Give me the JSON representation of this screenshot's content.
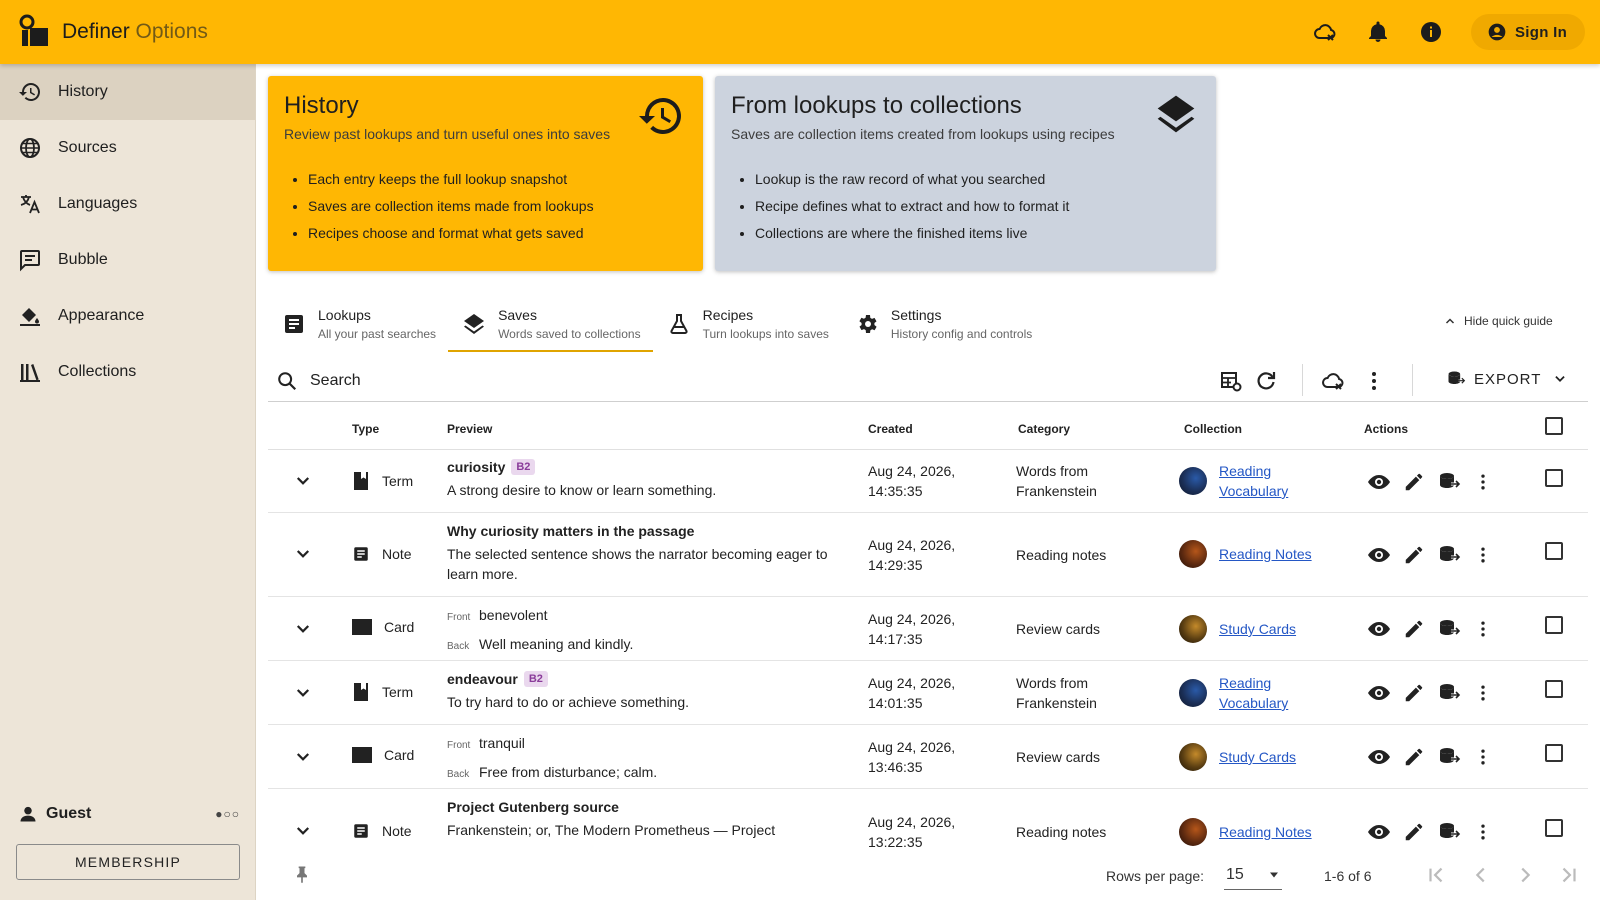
{
  "app": {
    "title_main": "Definer",
    "title_sub": "Options",
    "sign_in": "Sign In"
  },
  "topbar_icons": [
    "cloud-off-icon",
    "bell-icon",
    "info-icon"
  ],
  "sidebar": {
    "items": [
      {
        "label": "History",
        "icon": "history-icon",
        "active": true
      },
      {
        "label": "Sources",
        "icon": "globe-icon"
      },
      {
        "label": "Languages",
        "icon": "translate-icon"
      },
      {
        "label": "Bubble",
        "icon": "chat-bubble-icon"
      },
      {
        "label": "Appearance",
        "icon": "paint-bucket-icon"
      },
      {
        "label": "Collections",
        "icon": "library-icon"
      }
    ],
    "user": "Guest",
    "user_dots": "●○○",
    "membership": "MEMBERSHIP"
  },
  "guide": {
    "history": {
      "title": "History",
      "desc": "Review past lookups and turn useful ones into saves",
      "bullets": [
        "Each entry keeps the full lookup snapshot",
        "Saves are collection items made from lookups",
        "Recipes choose and format what gets saved"
      ]
    },
    "from": {
      "title": "From lookups to collections",
      "desc": "Saves are collection items created from lookups using recipes",
      "bullets": [
        "Lookup is the raw record of what you searched",
        "Recipe defines what to extract and how to format it",
        "Collections are where the finished items live"
      ]
    }
  },
  "tabs": [
    {
      "label": "Lookups",
      "sub": "All your past searches"
    },
    {
      "label": "Saves",
      "sub": "Words saved to collections",
      "active": true
    },
    {
      "label": "Recipes",
      "sub": "Turn lookups into saves"
    },
    {
      "label": "Settings",
      "sub": "History config and controls"
    }
  ],
  "hide_guide": "Hide quick guide",
  "search": {
    "placeholder": "Search"
  },
  "export": "EXPORT",
  "table": {
    "headers": {
      "type": "Type",
      "preview": "Preview",
      "created": "Created",
      "category": "Category",
      "collection": "Collection",
      "actions": "Actions"
    },
    "rows": [
      {
        "type": "Term",
        "title": "curiosity",
        "badge": "B2",
        "text": "A strong desire to know or learn something.",
        "created1": "Aug 24, 2026,",
        "created2": "14:35:35",
        "cat1": "Words from",
        "cat2": "Frankenstein",
        "coll1": "Reading",
        "coll2": "Vocabulary"
      },
      {
        "type": "Note",
        "title": "Why curiosity matters in the passage",
        "text1": "The selected sentence shows the narrator becoming eager to",
        "text2": "learn more.",
        "created1": "Aug 24, 2026,",
        "created2": "14:29:35",
        "cat1": "Reading notes",
        "coll1": "Reading Notes"
      },
      {
        "type": "Card",
        "front_label": "Front",
        "front": "benevolent",
        "back_label": "Back",
        "back": "Well meaning and kindly.",
        "created1": "Aug 24, 2026,",
        "created2": "14:17:35",
        "cat1": "Review cards",
        "coll1": "Study Cards"
      },
      {
        "type": "Term",
        "title": "endeavour",
        "badge": "B2",
        "text": "To try hard to do or achieve something.",
        "created1": "Aug 24, 2026,",
        "created2": "14:01:35",
        "cat1": "Words from",
        "cat2": "Frankenstein",
        "coll1": "Reading",
        "coll2": "Vocabulary"
      },
      {
        "type": "Card",
        "front_label": "Front",
        "front": "tranquil",
        "back_label": "Back",
        "back": "Free from disturbance; calm.",
        "created1": "Aug 24, 2026,",
        "created2": "13:46:35",
        "cat1": "Review cards",
        "coll1": "Study Cards"
      },
      {
        "type": "Note",
        "title": "Project Gutenberg source",
        "text": "Frankenstein; or, The Modern Prometheus — Project",
        "created1": "Aug 24, 2026,",
        "created2": "13:22:35",
        "cat1": "Reading notes",
        "coll1": "Reading Notes"
      }
    ]
  },
  "footer": {
    "rows_per_page_label": "Rows per page:",
    "rows_per_page": "15",
    "range": "1-6 of 6"
  },
  "colors": {
    "brand": "#ffb703",
    "sidebar": "#ede5d8",
    "info_card": "#ccd3de",
    "link": "#2457c5"
  }
}
